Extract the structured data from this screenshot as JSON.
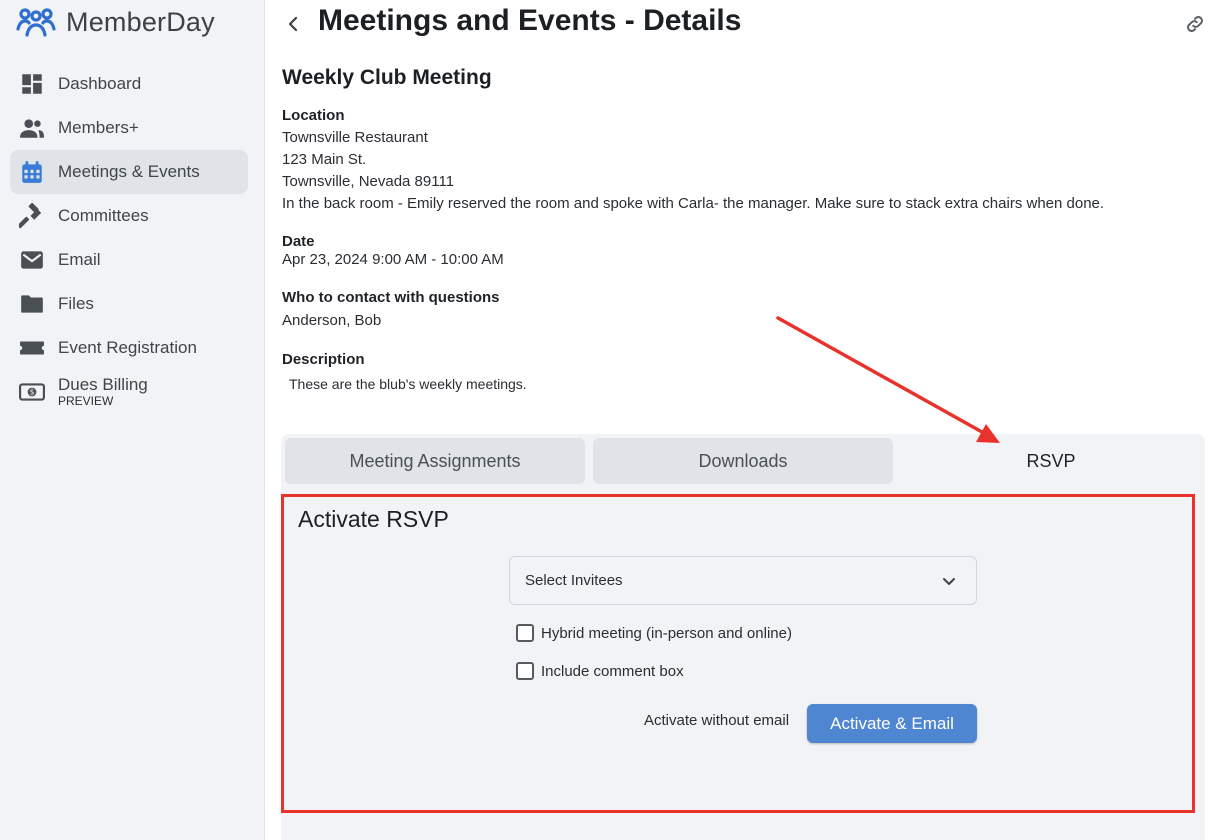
{
  "brand": {
    "name": "MemberDay",
    "color": "#2f6fd1"
  },
  "sidebar": {
    "items": [
      {
        "label": "Dashboard",
        "icon": "dashboard-icon"
      },
      {
        "label": "Members+",
        "icon": "people-icon"
      },
      {
        "label": "Meetings & Events",
        "icon": "calendar-icon",
        "active": true
      },
      {
        "label": "Committees",
        "icon": "gavel-icon"
      },
      {
        "label": "Email",
        "icon": "mail-icon"
      },
      {
        "label": "Files",
        "icon": "folder-icon"
      },
      {
        "label": "Event Registration",
        "icon": "ticket-icon"
      },
      {
        "label": "Dues Billing",
        "sub": "PREVIEW",
        "icon": "money-icon"
      }
    ]
  },
  "header": {
    "title": "Meetings and Events - Details",
    "back_icon": "chevron-left-icon",
    "link_icon": "link-icon"
  },
  "event": {
    "title": "Weekly Club Meeting",
    "location_label": "Location",
    "location_lines": [
      "Townsville Restaurant",
      "123 Main St.",
      "Townsville, Nevada 89111",
      "In the back room - Emily reserved the room and spoke with Carla- the manager. Make sure to stack extra chairs when done."
    ],
    "date_label": "Date",
    "date_value": "Apr 23, 2024 9:00 AM - 10:00 AM",
    "contact_label": "Who to contact with questions",
    "contact_value": "Anderson, Bob",
    "description_label": "Description",
    "description_value": "These are the blub's weekly meetings."
  },
  "tabs": [
    {
      "label": "Meeting Assignments"
    },
    {
      "label": "Downloads"
    },
    {
      "label": "RSVP",
      "active": true
    }
  ],
  "rsvp": {
    "title": "Activate RSVP",
    "select_placeholder": "Select Invitees",
    "hybrid_label": "Hybrid meeting (in-person and online)",
    "comment_label": "Include comment box",
    "without_email_label": "Activate without email",
    "activate_email_label": "Activate & Email"
  },
  "annotation_color": "#e8322b",
  "accent_color": "#4f86d1"
}
